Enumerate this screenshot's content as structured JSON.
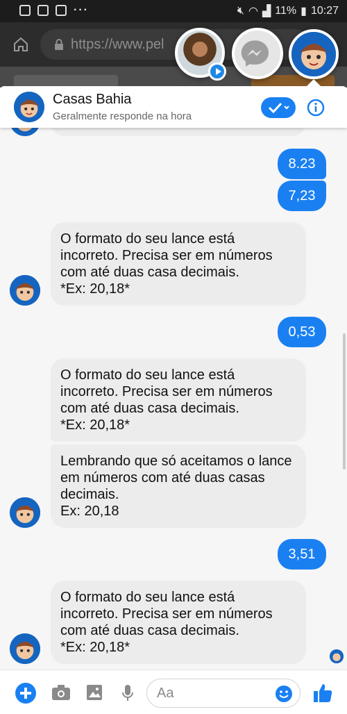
{
  "status_bar": {
    "battery": "11%",
    "time": "10:27"
  },
  "browser": {
    "url": "https://www.pel"
  },
  "chat": {
    "name": "Casas Bahia",
    "subtitle": "Geralmente responde na hora"
  },
  "messages": [
    {
      "side": "out",
      "text": "8.23"
    },
    {
      "side": "out",
      "text": "7,23"
    },
    {
      "side": "in",
      "text": "O formato do seu lance está incorreto. Precisa ser em números com até duas casa decimais.\n*Ex: 20,18*"
    },
    {
      "side": "out",
      "text": "0,53"
    },
    {
      "side": "in",
      "text": "O formato do seu lance está incorreto. Precisa ser em números com até duas casa decimais.\n*Ex: 20,18*"
    },
    {
      "side": "in",
      "text": "Lembrando que só aceitamos o lance em números com até duas casas decimais.\nEx: 20,18"
    },
    {
      "side": "out",
      "text": "3,51"
    },
    {
      "side": "in",
      "text": "O formato do seu lance está incorreto. Precisa ser em números com até duas casa decimais.\n*Ex: 20,18*"
    }
  ],
  "composer": {
    "placeholder": "Aa"
  },
  "colors": {
    "accent": "#1a80f2",
    "incoming_bubble": "#ececec",
    "chat_background": "#f6f6f6"
  }
}
